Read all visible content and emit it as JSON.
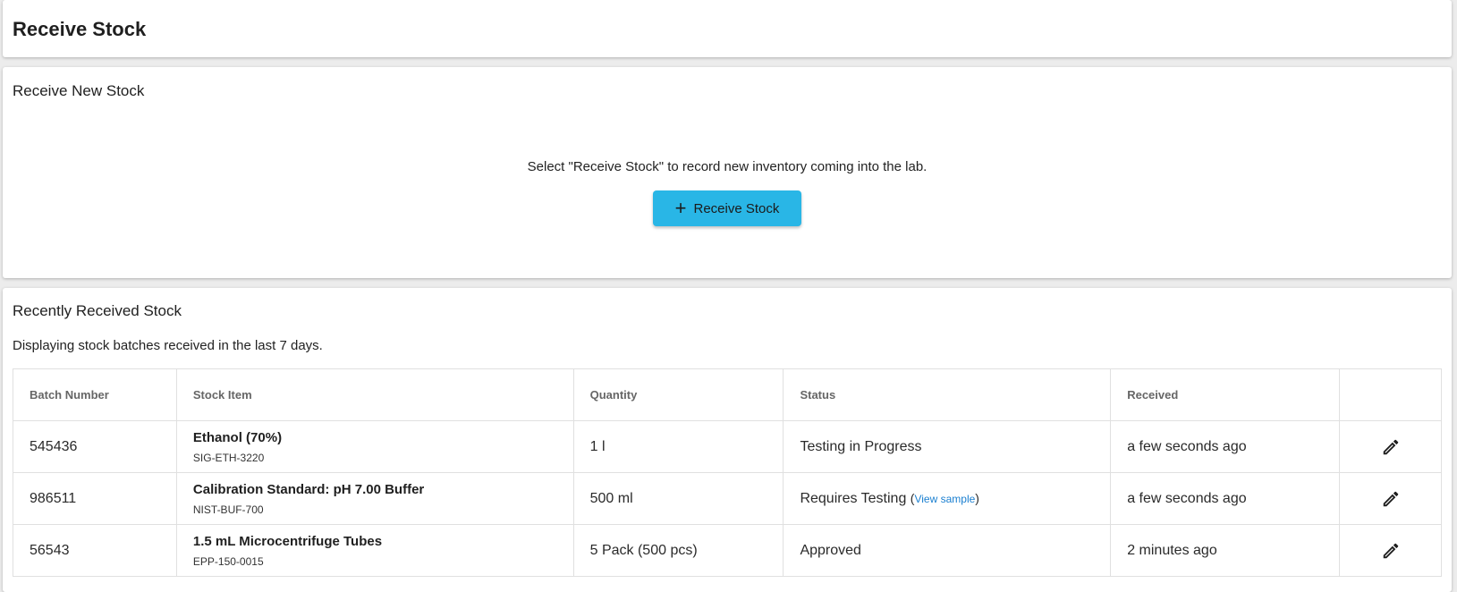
{
  "header": {
    "title": "Receive Stock"
  },
  "receive_section": {
    "title": "Receive New Stock",
    "hint": "Select \"Receive Stock\" to record new inventory coming into the lab.",
    "button_label": "Receive Stock",
    "button_icon": "plus-icon",
    "button_color": "#29b6e6"
  },
  "recent_section": {
    "title": "Recently Received Stock",
    "description": "Displaying stock batches received in the last 7 days.",
    "columns": [
      "Batch Number",
      "Stock Item",
      "Quantity",
      "Status",
      "Received",
      ""
    ],
    "rows": [
      {
        "batch": "545436",
        "item_name": "Ethanol (70%)",
        "item_code": "SIG-ETH-3220",
        "quantity": "1 l",
        "status": "Testing in Progress",
        "status_link": "",
        "received": "a few seconds ago",
        "action_icon": "pencil-icon"
      },
      {
        "batch": "986511",
        "item_name": "Calibration Standard: pH 7.00 Buffer",
        "item_code": "NIST-BUF-700",
        "quantity": "500 ml",
        "status": "Requires Testing",
        "status_link": "View sample",
        "received": "a few seconds ago",
        "action_icon": "pencil-icon"
      },
      {
        "batch": "56543",
        "item_name": "1.5 mL Microcentrifuge Tubes",
        "item_code": "EPP-150-0015",
        "quantity": "5 Pack (500 pcs)",
        "status": "Approved",
        "status_link": "",
        "received": "2 minutes ago",
        "action_icon": "pencil-icon"
      }
    ]
  }
}
